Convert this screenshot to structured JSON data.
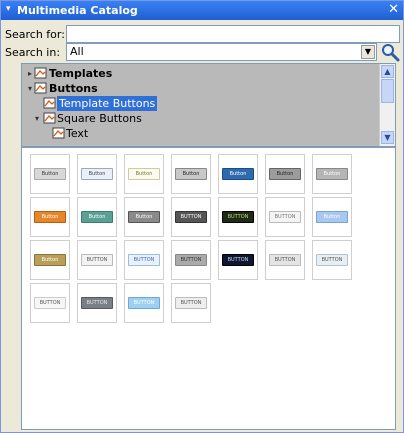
{
  "panel": {
    "title": "Multimedia Catalog"
  },
  "search": {
    "search_for_label": "Search for:",
    "search_for_value": "",
    "search_in_label": "Search in:",
    "search_in_value": "All"
  },
  "tree": {
    "items": [
      {
        "label": "Templates",
        "toggle": "▸",
        "bold": true
      },
      {
        "label": "Buttons",
        "toggle": "▾",
        "bold": true
      },
      {
        "label": "Template Buttons",
        "toggle": "",
        "selected": true
      },
      {
        "label": "Square Buttons",
        "toggle": "▾",
        "bold": false
      },
      {
        "label": "Text",
        "toggle": "",
        "bold": false
      }
    ]
  },
  "grid": {
    "items": [
      {
        "label": "Button",
        "bg": "#d8d8d8",
        "fg": "#333333",
        "border": "#aaaaaa"
      },
      {
        "label": "Button",
        "bg": "#eaf0f6",
        "fg": "#345",
        "border": "#9ab"
      },
      {
        "label": "Button",
        "bg": "#fafaf2",
        "fg": "#7a7a20",
        "border": "#cccc99"
      },
      {
        "label": "Button",
        "bg": "#c8c8c8",
        "fg": "#222222",
        "border": "#888888"
      },
      {
        "label": "Button",
        "bg": "#2e6ab0",
        "fg": "#ffffff",
        "border": "#1d4c85"
      },
      {
        "label": "Button",
        "bg": "#9c9c9c",
        "fg": "#222222",
        "border": "#666666"
      },
      {
        "label": "Button",
        "bg": "#b5b5b5",
        "fg": "#ffffff",
        "border": "#888888"
      },
      {
        "label": "Button",
        "bg": "#e6862a",
        "fg": "#ffffff",
        "border": "#b45e10"
      },
      {
        "label": "Button",
        "bg": "#5aa095",
        "fg": "#ffffff",
        "border": "#3c7d72"
      },
      {
        "label": "Button",
        "bg": "#8a8a8a",
        "fg": "#ffffff",
        "border": "#555555"
      },
      {
        "label": "BUTTON",
        "bg": "#555555",
        "fg": "#ffffff",
        "border": "#333333"
      },
      {
        "label": "BUTTON",
        "bg": "#1e2a14",
        "fg": "#b7d88a",
        "border": "#000000"
      },
      {
        "label": "BUTTON",
        "bg": "#f4f4f4",
        "fg": "#777777",
        "border": "#bbbbbb"
      },
      {
        "label": "Button",
        "bg": "#a9c8ee",
        "fg": "#ffffff",
        "border": "#7aa2d6"
      },
      {
        "label": "Button",
        "bg": "#b8a05a",
        "fg": "#ffffff",
        "border": "#8a7438"
      },
      {
        "label": "BUTTON",
        "bg": "#f2f2f2",
        "fg": "#555555",
        "border": "#bbbbbb"
      },
      {
        "label": "BUTTON",
        "bg": "#eaf1fb",
        "fg": "#3a6ab8",
        "border": "#9fbbe0"
      },
      {
        "label": "BUTTON",
        "bg": "#aaaaaa",
        "fg": "#333333",
        "border": "#888888"
      },
      {
        "label": "BUTTON",
        "bg": "#0d1830",
        "fg": "#cfd8ef",
        "border": "#000000"
      },
      {
        "label": "BUTTON",
        "bg": "#e4e4e4",
        "fg": "#555555",
        "border": "#bbbbbb"
      },
      {
        "label": "BUTTON",
        "bg": "#e9eef3",
        "fg": "#555555",
        "border": "#b3c1cf"
      },
      {
        "label": "BUTTON",
        "bg": "#f6f6f6",
        "fg": "#555555",
        "border": "#cccccc"
      },
      {
        "label": "BUTTON",
        "bg": "#7a7f86",
        "fg": "#e8e8e8",
        "border": "#555a60"
      },
      {
        "label": "BUTTON",
        "bg": "#9fd0f0",
        "fg": "#ffffff",
        "border": "#6fa8d0"
      },
      {
        "label": "BUTTON",
        "bg": "#eeeeee",
        "fg": "#555555",
        "border": "#bbbbbb"
      }
    ]
  }
}
